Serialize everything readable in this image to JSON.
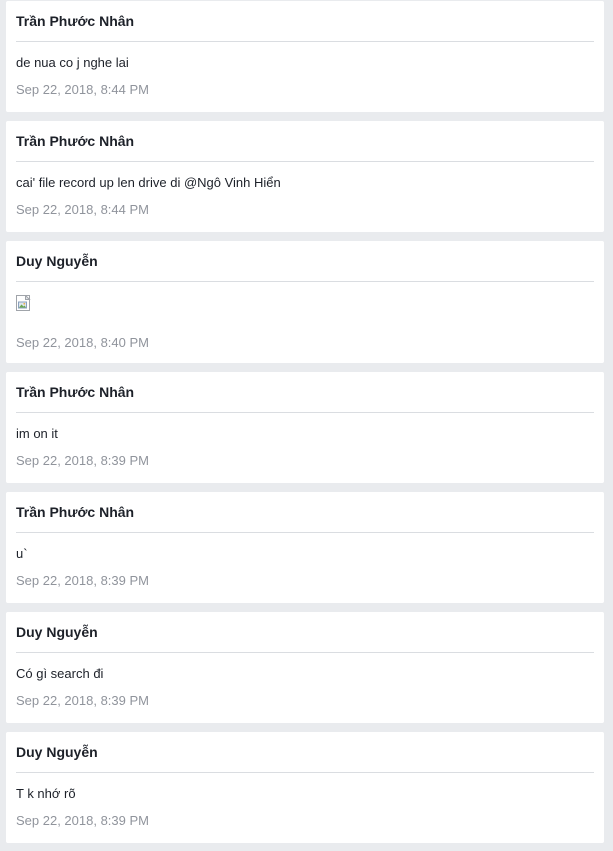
{
  "messages": [
    {
      "author": "Trần Phước Nhân",
      "text": "de nua co j nghe lai",
      "time": "Sep 22, 2018, 8:44 PM"
    },
    {
      "author": "Trần Phước Nhân",
      "text": "cai' file record up len drive di @Ngô Vinh Hiển",
      "time": "Sep 22, 2018, 8:44 PM"
    },
    {
      "author": "Duy Nguyễn",
      "image": "broken-image-icon",
      "time": "Sep 22, 2018, 8:40 PM"
    },
    {
      "author": "Trần Phước Nhân",
      "text": "im on it",
      "time": "Sep 22, 2018, 8:39 PM"
    },
    {
      "author": "Trần Phước Nhân",
      "text": "u`",
      "time": "Sep 22, 2018, 8:39 PM"
    },
    {
      "author": "Duy Nguyễn",
      "text": "Có gì search đi",
      "time": "Sep 22, 2018, 8:39 PM"
    },
    {
      "author": "Duy Nguyễn",
      "text": "T k nhớ rõ",
      "time": "Sep 22, 2018, 8:39 PM"
    }
  ]
}
